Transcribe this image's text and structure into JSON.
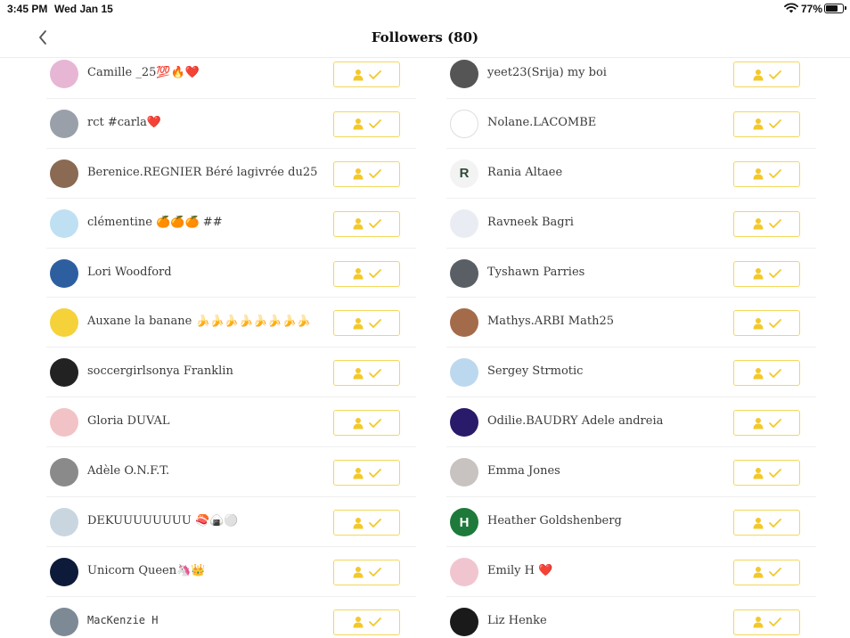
{
  "status_bar": {
    "time": "3:45 PM",
    "date": "Wed Jan 15",
    "battery": "77%",
    "battery_level": 0.77
  },
  "header": {
    "title": "Followers (80)",
    "back_icon": "chevron-left-icon"
  },
  "colors": {
    "accent": "#f3c82a",
    "button_border": "#f3d75a",
    "divider": "#efefef"
  },
  "follow_button_icon": "person-check-icon",
  "followers_left": [
    {
      "name": "Camille _25💯🔥❤️",
      "avatar": "#e7b6d4"
    },
    {
      "name": "rct #carla❤️",
      "avatar": "#9aa0aa"
    },
    {
      "name": "Berenice.REGNIER Béré lagivrée du25",
      "avatar": "#8a6a52"
    },
    {
      "name": "clémentine 🍊🍊🍊 ##",
      "avatar": "#bfe0f2"
    },
    {
      "name": "Lori Woodford",
      "avatar": "#2d5fa0"
    },
    {
      "name": "Auxane la banane 🍌🍌🍌🍌🍌🍌🍌🍌",
      "avatar": "#f5d23a"
    },
    {
      "name": "soccergirlsonya Franklin",
      "avatar": "#222222"
    },
    {
      "name": "Gloria DUVAL",
      "avatar": "#f2c3c6"
    },
    {
      "name": "Adèle O.N.F.T.",
      "avatar": "#8a8a8a"
    },
    {
      "name": "DEKUUUUUUUU 🍣🍙⚪",
      "avatar": "#c9d6e0"
    },
    {
      "name": "Unicorn Queen🦄👑",
      "avatar": "#0e1a3a"
    },
    {
      "name": "MacKenzie H",
      "avatar": "#7d8a95",
      "mono": true
    }
  ],
  "followers_right": [
    {
      "name": "yeet23(Srija) my boi",
      "avatar": "#555555"
    },
    {
      "name": "Nolane.LACOMBE",
      "avatar": "#ffffff"
    },
    {
      "name": "Rania Altaee",
      "avatar": "#f3f3f3",
      "initial": "R",
      "initial_color": "#2e4a3a"
    },
    {
      "name": "Ravneek Bagri",
      "avatar": "#e9edf3"
    },
    {
      "name": "Tyshawn Parries",
      "avatar": "#5a5f66"
    },
    {
      "name": "Mathys.ARBI Math25",
      "avatar": "#a46b4a"
    },
    {
      "name": "Sergey Strmotic",
      "avatar": "#bcd8ef"
    },
    {
      "name": "Odilie.BAUDRY Adele andreia",
      "avatar": "#2a1a6a"
    },
    {
      "name": "Emma Jones",
      "avatar": "#c8c3c0"
    },
    {
      "name": "Heather Goldshenberg",
      "avatar": "#1e7a3a",
      "initial": "H",
      "initial_color": "#ffffff"
    },
    {
      "name": "Emily H ❤️",
      "avatar": "#f1c5cf"
    },
    {
      "name": "Liz Henke",
      "avatar": "#1a1a1a"
    }
  ]
}
